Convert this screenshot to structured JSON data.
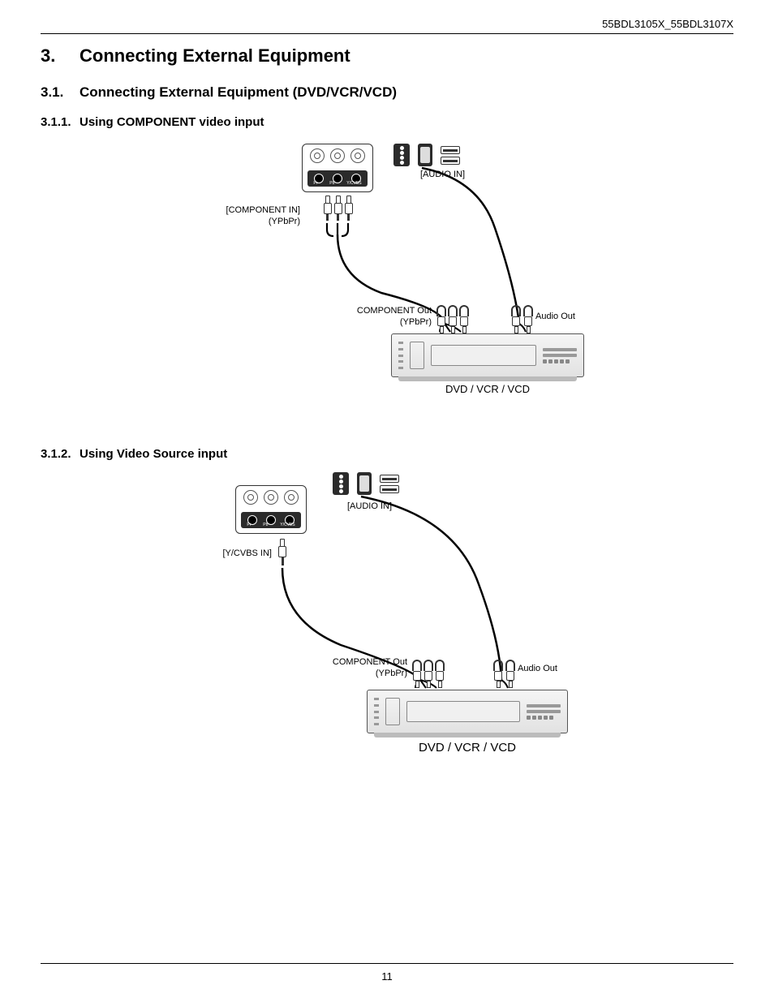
{
  "header": {
    "model_line": "55BDL3105X_55BDL3107X"
  },
  "headings": {
    "h1_num": "3.",
    "h1_text": "Connecting External Equipment",
    "h2_num": "3.1.",
    "h2_text": "Connecting External Equipment (DVD/VCR/VCD)",
    "h3a_num": "3.1.1.",
    "h3a_text": "Using COMPONENT video input",
    "h3b_num": "3.1.2.",
    "h3b_text": "Using Video Source input"
  },
  "diagram1": {
    "audio_in": "[AUDIO IN]",
    "component_in_line1": "[COMPONENT IN]",
    "component_in_line2": "(YPbPr)",
    "component_out_line1": "COMPONENT Out",
    "component_out_line2": "(YPbPr)",
    "audio_out": "Audio Out",
    "device_caption": "DVD / VCR / VCD",
    "panel_ports": {
      "left": "Pr",
      "mid": "Pb",
      "right": "Y/CVBS"
    }
  },
  "diagram2": {
    "audio_in": "[AUDIO IN]",
    "ycvbs_in": "[Y/CVBS IN]",
    "component_out_line1": "COMPONENT Out",
    "component_out_line2": "(YPbPr)",
    "audio_out": "Audio Out",
    "device_caption": "DVD / VCR / VCD",
    "panel_ports": {
      "left": "Pr",
      "mid": "Pb",
      "right": "Y/CVBS"
    }
  },
  "footer": {
    "page_number": "11"
  }
}
